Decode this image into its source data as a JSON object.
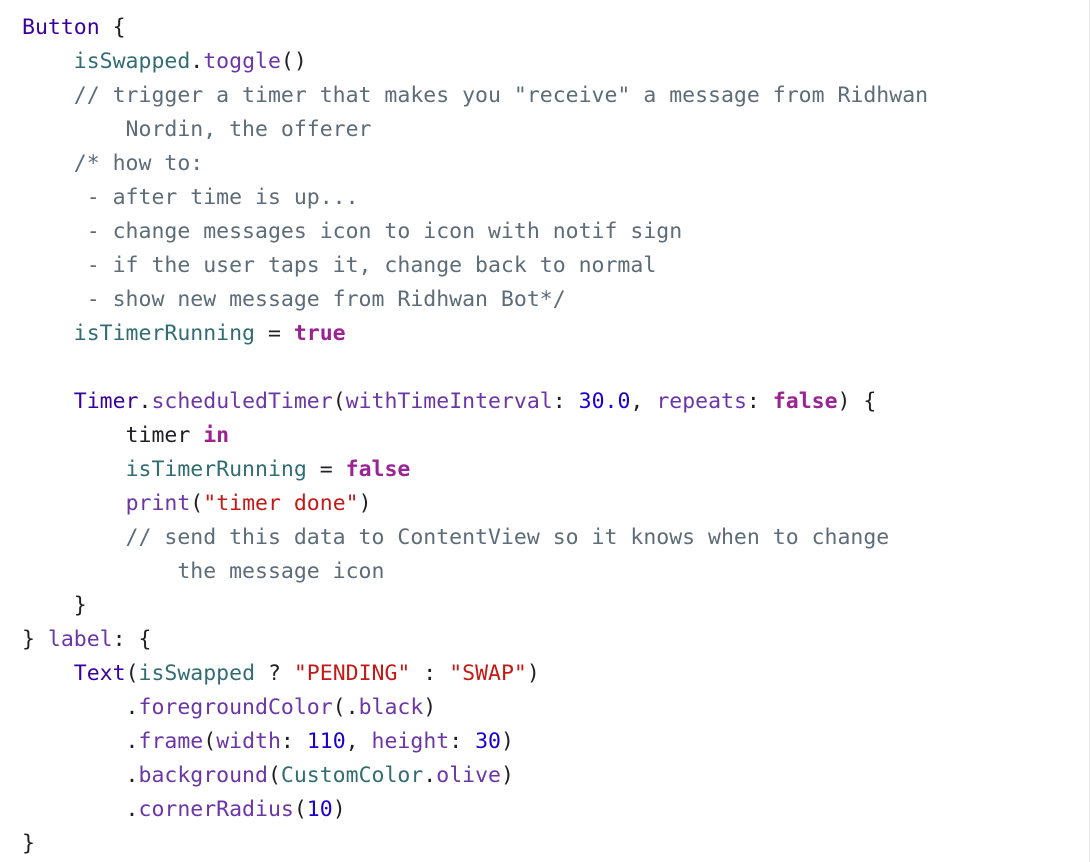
{
  "editor": {
    "background": "#ffffff",
    "colors": {
      "keyword": "#9b2393",
      "type": "#3900a0",
      "method": "#6c36a9",
      "property": "#326d74",
      "number": "#1c00cf",
      "string": "#c41a16",
      "comment": "#5d6c79",
      "plain": "#1f1f24"
    },
    "lines": [
      [
        {
          "t": "Button",
          "c": "type"
        },
        {
          "t": " {",
          "c": "plain"
        }
      ],
      [
        {
          "t": "    ",
          "c": "plain"
        },
        {
          "t": "isSwapped",
          "c": "prop"
        },
        {
          "t": ".",
          "c": "plain"
        },
        {
          "t": "toggle",
          "c": "method"
        },
        {
          "t": "()",
          "c": "plain"
        }
      ],
      [
        {
          "t": "    // trigger a timer that makes you \"receive\" a message from Ridhwan",
          "c": "comment"
        }
      ],
      [
        {
          "t": "        Nordin, the offerer",
          "c": "comment"
        }
      ],
      [
        {
          "t": "    /* how to:",
          "c": "comment"
        }
      ],
      [
        {
          "t": "     - after time is up...",
          "c": "comment"
        }
      ],
      [
        {
          "t": "     - change messages icon to icon with notif sign",
          "c": "comment"
        }
      ],
      [
        {
          "t": "     - if the user taps it, change back to normal",
          "c": "comment"
        }
      ],
      [
        {
          "t": "     - show new message from Ridhwan Bot*/",
          "c": "comment"
        }
      ],
      [
        {
          "t": "    ",
          "c": "plain"
        },
        {
          "t": "isTimerRunning",
          "c": "prop"
        },
        {
          "t": " = ",
          "c": "plain"
        },
        {
          "t": "true",
          "c": "kw"
        }
      ],
      [
        {
          "t": "",
          "c": "plain"
        }
      ],
      [
        {
          "t": "    ",
          "c": "plain"
        },
        {
          "t": "Timer",
          "c": "type"
        },
        {
          "t": ".",
          "c": "plain"
        },
        {
          "t": "scheduledTimer",
          "c": "method"
        },
        {
          "t": "(",
          "c": "plain"
        },
        {
          "t": "withTimeInterval",
          "c": "param"
        },
        {
          "t": ": ",
          "c": "plain"
        },
        {
          "t": "30.0",
          "c": "num"
        },
        {
          "t": ", ",
          "c": "plain"
        },
        {
          "t": "repeats",
          "c": "param"
        },
        {
          "t": ": ",
          "c": "plain"
        },
        {
          "t": "false",
          "c": "kw"
        },
        {
          "t": ") {",
          "c": "plain"
        }
      ],
      [
        {
          "t": "        timer ",
          "c": "var"
        },
        {
          "t": "in",
          "c": "kw"
        }
      ],
      [
        {
          "t": "        ",
          "c": "plain"
        },
        {
          "t": "isTimerRunning",
          "c": "prop"
        },
        {
          "t": " = ",
          "c": "plain"
        },
        {
          "t": "false",
          "c": "kw"
        }
      ],
      [
        {
          "t": "        ",
          "c": "plain"
        },
        {
          "t": "print",
          "c": "method"
        },
        {
          "t": "(",
          "c": "plain"
        },
        {
          "t": "\"timer done\"",
          "c": "str"
        },
        {
          "t": ")",
          "c": "plain"
        }
      ],
      [
        {
          "t": "        // send this data to ContentView so it knows when to change",
          "c": "comment"
        }
      ],
      [
        {
          "t": "            the message icon",
          "c": "comment"
        }
      ],
      [
        {
          "t": "    }",
          "c": "plain"
        }
      ],
      [
        {
          "t": "} ",
          "c": "plain"
        },
        {
          "t": "label",
          "c": "param"
        },
        {
          "t": ": {",
          "c": "plain"
        }
      ],
      [
        {
          "t": "    ",
          "c": "plain"
        },
        {
          "t": "Text",
          "c": "type"
        },
        {
          "t": "(",
          "c": "plain"
        },
        {
          "t": "isSwapped",
          "c": "prop"
        },
        {
          "t": " ? ",
          "c": "plain"
        },
        {
          "t": "\"PENDING\"",
          "c": "str"
        },
        {
          "t": " : ",
          "c": "plain"
        },
        {
          "t": "\"SWAP\"",
          "c": "str"
        },
        {
          "t": ")",
          "c": "plain"
        }
      ],
      [
        {
          "t": "        .",
          "c": "plain"
        },
        {
          "t": "foregroundColor",
          "c": "method"
        },
        {
          "t": "(.",
          "c": "plain"
        },
        {
          "t": "black",
          "c": "method"
        },
        {
          "t": ")",
          "c": "plain"
        }
      ],
      [
        {
          "t": "        .",
          "c": "plain"
        },
        {
          "t": "frame",
          "c": "method"
        },
        {
          "t": "(",
          "c": "plain"
        },
        {
          "t": "width",
          "c": "param"
        },
        {
          "t": ": ",
          "c": "plain"
        },
        {
          "t": "110",
          "c": "num"
        },
        {
          "t": ", ",
          "c": "plain"
        },
        {
          "t": "height",
          "c": "param"
        },
        {
          "t": ": ",
          "c": "plain"
        },
        {
          "t": "30",
          "c": "num"
        },
        {
          "t": ")",
          "c": "plain"
        }
      ],
      [
        {
          "t": "        .",
          "c": "plain"
        },
        {
          "t": "background",
          "c": "method"
        },
        {
          "t": "(",
          "c": "plain"
        },
        {
          "t": "CustomColor",
          "c": "prop"
        },
        {
          "t": ".",
          "c": "plain"
        },
        {
          "t": "olive",
          "c": "method"
        },
        {
          "t": ")",
          "c": "plain"
        }
      ],
      [
        {
          "t": "        .",
          "c": "plain"
        },
        {
          "t": "cornerRadius",
          "c": "method"
        },
        {
          "t": "(",
          "c": "plain"
        },
        {
          "t": "10",
          "c": "num"
        },
        {
          "t": ")",
          "c": "plain"
        }
      ],
      [
        {
          "t": "}",
          "c": "plain"
        }
      ]
    ]
  }
}
